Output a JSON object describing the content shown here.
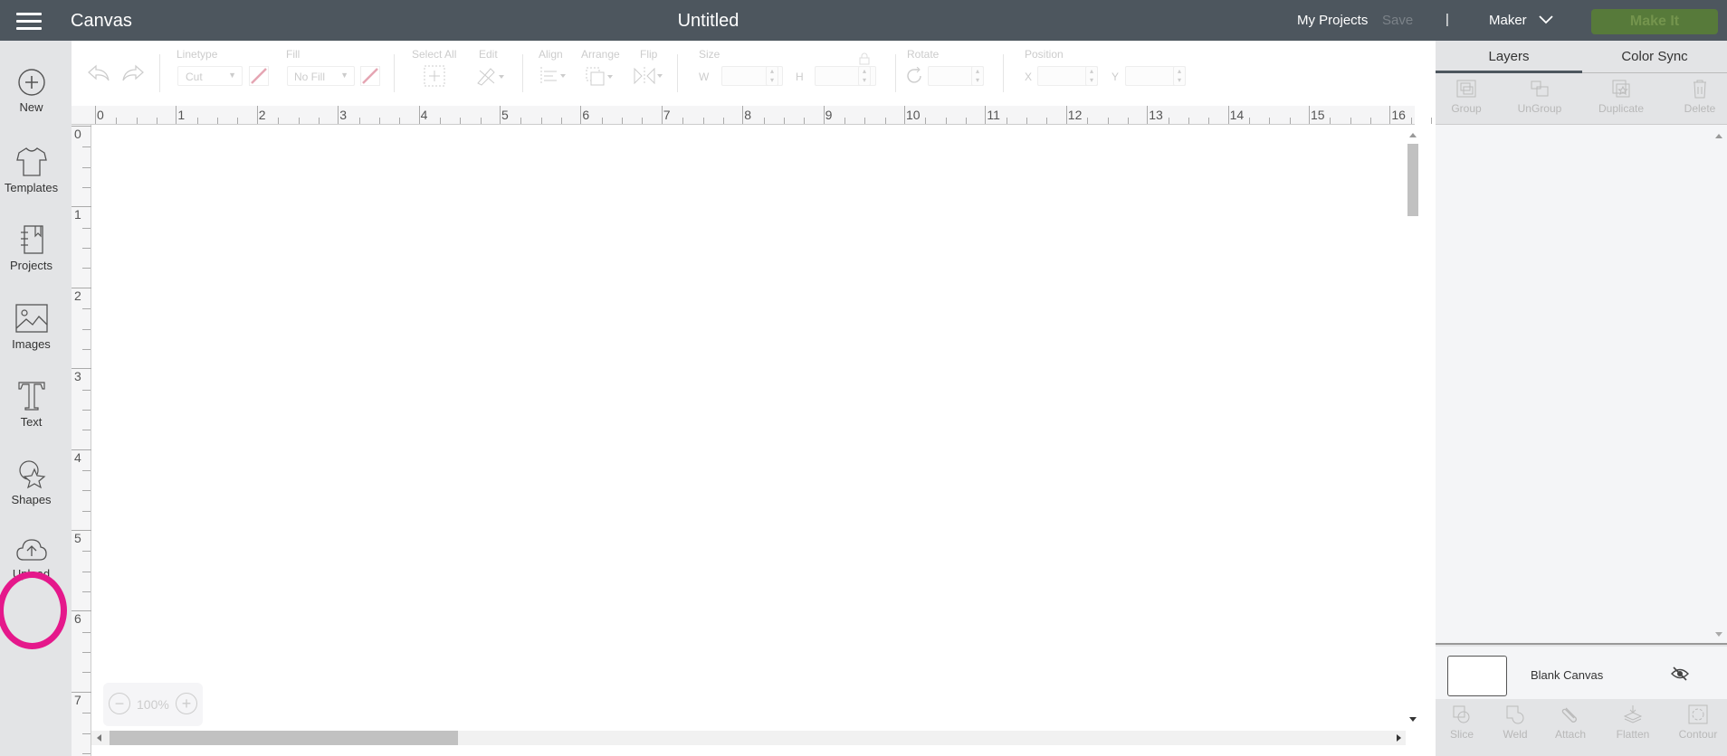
{
  "topbar": {
    "menu_icon": "hamburger-menu-icon",
    "app_title": "Canvas",
    "document_title": "Untitled",
    "my_projects": "My Projects",
    "save": "Save",
    "separator": "|",
    "machine": "Maker",
    "make_it": "Make It",
    "colors": {
      "bar": "#4d565e",
      "make_it": "#577a3a"
    }
  },
  "sidebar": {
    "items": [
      {
        "label": "New",
        "icon": "plus-circle-icon"
      },
      {
        "label": "Templates",
        "icon": "tshirt-icon"
      },
      {
        "label": "Projects",
        "icon": "notebook-icon"
      },
      {
        "label": "Images",
        "icon": "image-icon"
      },
      {
        "label": "Text",
        "icon": "text-t-icon"
      },
      {
        "label": "Shapes",
        "icon": "shapes-icon"
      },
      {
        "label": "Upload",
        "icon": "cloud-upload-icon"
      }
    ],
    "highlight_color": "#e5188b"
  },
  "toolbar": {
    "linetype_label": "Linetype",
    "linetype_value": "Cut",
    "fill_label": "Fill",
    "fill_value": "No Fill",
    "select_all_label": "Select All",
    "edit_label": "Edit",
    "align_label": "Align",
    "arrange_label": "Arrange",
    "flip_label": "Flip",
    "size_label": "Size",
    "w_label": "W",
    "h_label": "H",
    "rotate_label": "Rotate",
    "position_label": "Position",
    "x_label": "X",
    "y_label": "Y"
  },
  "ruler": {
    "horizontal": [
      "0",
      "1",
      "2",
      "3",
      "4",
      "5",
      "6",
      "7",
      "8",
      "9",
      "10",
      "11",
      "12",
      "13",
      "14",
      "15",
      "16"
    ],
    "vertical": [
      "0",
      "1",
      "2",
      "3",
      "4",
      "5",
      "6",
      "7"
    ]
  },
  "zoom": {
    "value": "100%"
  },
  "panel": {
    "tabs": [
      {
        "label": "Layers",
        "active": true
      },
      {
        "label": "Color Sync",
        "active": false
      }
    ],
    "top_actions": [
      "Group",
      "UnGroup",
      "Duplicate",
      "Delete"
    ],
    "layer_name": "Blank Canvas",
    "bottom_actions": [
      "Slice",
      "Weld",
      "Attach",
      "Flatten",
      "Contour"
    ]
  }
}
